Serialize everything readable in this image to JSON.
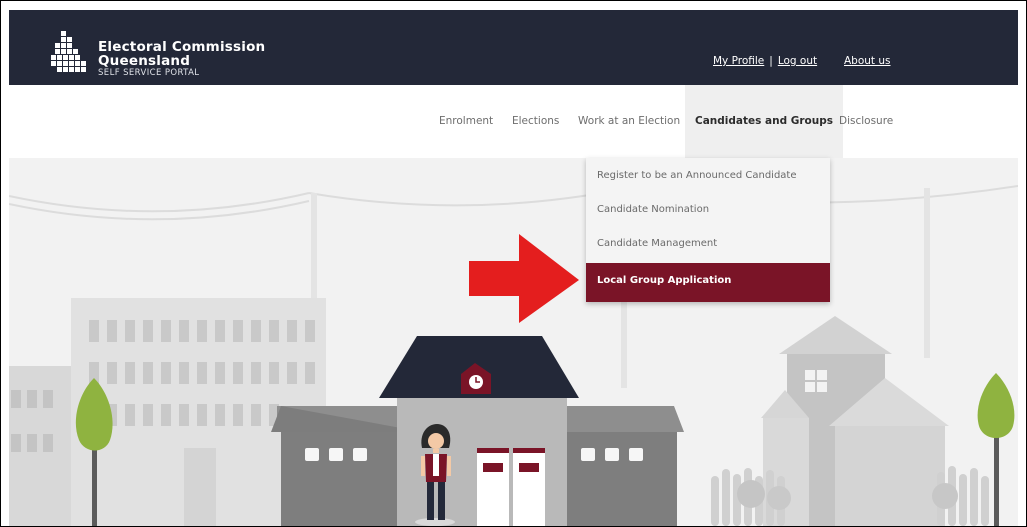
{
  "logo": {
    "line1": "Electoral Commission",
    "line2": "Queensland",
    "line3": "SELF SERVICE PORTAL"
  },
  "top_links": {
    "profile": "My Profile",
    "separator": "|",
    "logout": "Log out",
    "about": "About us"
  },
  "nav": {
    "items": [
      {
        "label": "Enrolment"
      },
      {
        "label": "Elections"
      },
      {
        "label": "Work at an Election"
      },
      {
        "label": "Candidates and Groups",
        "active": true
      },
      {
        "label": "Disclosure"
      }
    ]
  },
  "dropdown": {
    "items": [
      {
        "label": "Register to be an Announced Candidate"
      },
      {
        "label": "Candidate Nomination"
      },
      {
        "label": "Candidate Management"
      },
      {
        "label": "Local Group Application",
        "selected": true
      }
    ]
  },
  "colors": {
    "header_bg": "#232838",
    "accent_maroon": "#7a1427",
    "arrow_red": "#e41e1e",
    "tree_green": "#8fb340"
  },
  "icons": [
    "logo-mark-icon",
    "clock-icon",
    "red-arrow-icon"
  ]
}
